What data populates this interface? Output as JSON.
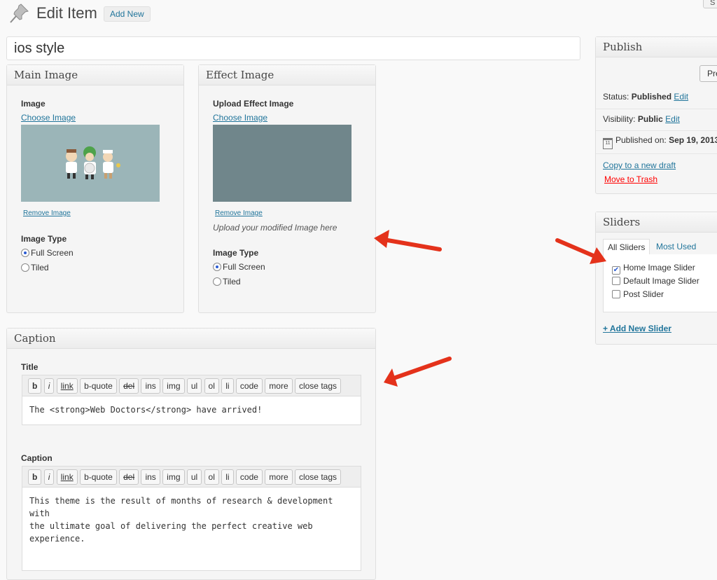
{
  "header": {
    "title": "Edit Item",
    "add_new": "Add New",
    "top_button": "S"
  },
  "post_title": "ios style",
  "main_image": {
    "heading": "Main Image",
    "image_label": "Image",
    "choose": "Choose Image",
    "remove": "Remove Image",
    "type_label": "Image Type",
    "options": [
      "Full Screen",
      "Tiled"
    ],
    "selected": "Full Screen"
  },
  "effect_image": {
    "heading": "Effect Image",
    "upload_label": "Upload Effect Image",
    "choose": "Choose Image",
    "remove": "Remove Image",
    "hint": "Upload your modified Image here",
    "type_label": "Image Type",
    "options": [
      "Full Screen",
      "Tiled"
    ],
    "selected": "Full Screen"
  },
  "caption_box": {
    "heading": "Caption",
    "title_label": "Title",
    "title_value": "The <strong>Web Doctors</strong> have arrived!",
    "caption_label": "Caption",
    "caption_value": "This theme is the result of months of research & development with\nthe ultimate goal of delivering the perfect creative web\nexperience.",
    "quicktags": [
      "b",
      "i",
      "link",
      "b-quote",
      "del",
      "ins",
      "img",
      "ul",
      "ol",
      "li",
      "code",
      "more",
      "close tags"
    ]
  },
  "publish": {
    "heading": "Publish",
    "preview_button": "Pre",
    "status_label": "Status:",
    "status_value": "Published",
    "status_edit": "Edit",
    "visibility_label": "Visibility:",
    "visibility_value": "Public",
    "visibility_edit": "Edit",
    "published_label": "Published on:",
    "published_value": "Sep 19, 2013",
    "copy_draft": "Copy to a new draft",
    "move_trash": "Move to Trash"
  },
  "sliders": {
    "heading": "Sliders",
    "tabs": [
      "All Sliders",
      "Most Used"
    ],
    "items": [
      {
        "label": "Home Image Slider",
        "checked": true
      },
      {
        "label": "Default Image Slider",
        "checked": false
      },
      {
        "label": "Post Slider",
        "checked": false
      }
    ],
    "add_new": "+ Add New Slider"
  },
  "colors": {
    "link": "#21759b",
    "trash": "#ff0000",
    "arrow": "#e4321b",
    "main_image_bg": "#9bb5b8",
    "effect_image_bg": "#70868b"
  }
}
